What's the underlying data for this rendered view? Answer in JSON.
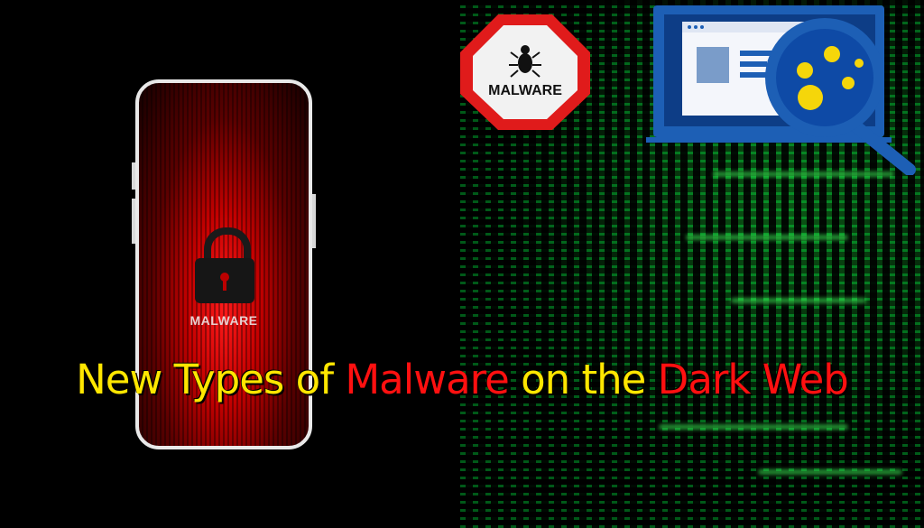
{
  "badge": {
    "label": "MALWARE"
  },
  "phone": {
    "label": "MALWARE"
  },
  "headline": {
    "part1": "New Types of ",
    "part2": "Malware",
    "part3": " on the ",
    "part4": "Dark Web"
  },
  "colors": {
    "yellow": "#ffe600",
    "red": "#ff1010",
    "green": "#1aff4a"
  },
  "icons": [
    "matrix-background",
    "smartphone",
    "padlock-icon",
    "malware-badge",
    "bug-icon",
    "laptop-scan-icon",
    "magnifier-icon",
    "virus-icon"
  ]
}
